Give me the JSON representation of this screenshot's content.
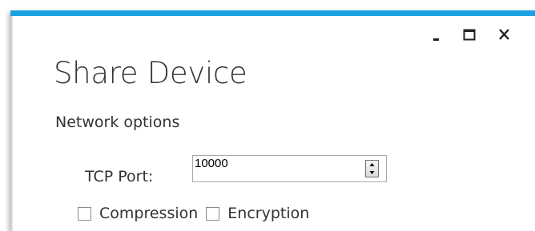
{
  "window": {
    "title": "Share Device",
    "controls": {
      "minimize_icon": "minimize-icon",
      "maximize_icon": "maximize-icon",
      "close_icon": "close-icon"
    },
    "accent_color": "#1ba1e2"
  },
  "network": {
    "section_label": "Network options",
    "tcp_port": {
      "label": "TCP Port:",
      "value": "10000"
    },
    "compression": {
      "label": "Compression",
      "checked": false
    },
    "encryption": {
      "label": "Encryption",
      "checked": false
    }
  }
}
